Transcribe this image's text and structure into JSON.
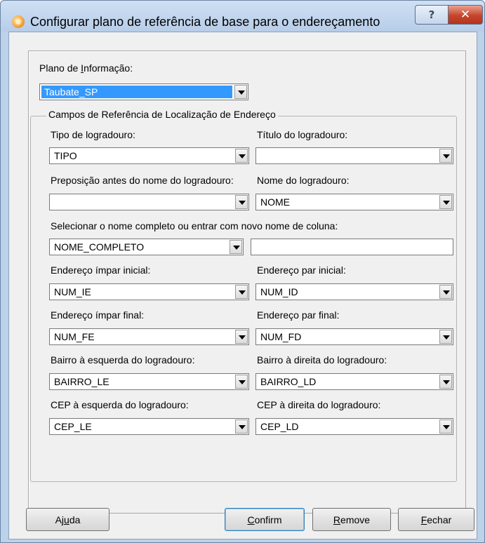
{
  "window": {
    "title": "Configurar plano de referência de base para o endereçamento",
    "help_label": "?",
    "close_label": "✕"
  },
  "plano": {
    "label_pre": "Plano de ",
    "label_accel": "I",
    "label_post": "nformação:",
    "value": "Taubate_SP"
  },
  "group": {
    "title": "Campos de Referência de Localização de Endereço"
  },
  "fields": {
    "tipo": {
      "label": "Tipo de logradouro:",
      "value": "TIPO"
    },
    "titulo": {
      "label": "Título do logradouro:",
      "value": ""
    },
    "preposicao": {
      "label": "Preposição antes do nome do logradouro:",
      "value": ""
    },
    "nome": {
      "label": "Nome do logradouro:",
      "value": "NOME"
    },
    "nome_completo": {
      "label": "Selecionar o nome completo ou entrar com novo nome de coluna:",
      "value": "NOME_COMPLETO",
      "new_column": ""
    },
    "impar_inicial": {
      "label": "Endereço ímpar inicial:",
      "value": "NUM_IE"
    },
    "par_inicial": {
      "label": "Endereço par inicial:",
      "value": "NUM_ID"
    },
    "impar_final": {
      "label": "Endereço ímpar final:",
      "value": "NUM_FE"
    },
    "par_final": {
      "label": "Endereço par final:",
      "value": "NUM_FD"
    },
    "bairro_esq": {
      "label": "Bairro à esquerda do logradouro:",
      "value": "BAIRRO_LE"
    },
    "bairro_dir": {
      "label": "Bairro à direita do logradouro:",
      "value": "BAIRRO_LD"
    },
    "cep_esq": {
      "label": "CEP à esquerda do logradouro:",
      "value": "CEP_LE"
    },
    "cep_dir": {
      "label": "CEP à direita do logradouro:",
      "value": "CEP_LD"
    }
  },
  "buttons": {
    "ajuda": {
      "pre": "Aj",
      "accel": "u",
      "post": "da"
    },
    "confirm": {
      "pre": "",
      "accel": "C",
      "post": "onfirm"
    },
    "remove": {
      "pre": "",
      "accel": "R",
      "post": "emove"
    },
    "fechar": {
      "pre": "",
      "accel": "F",
      "post": "echar"
    }
  },
  "colors": {
    "selection": "#3399ff",
    "close_button": "#c6452b",
    "titlebar": "#bcd1ea"
  }
}
